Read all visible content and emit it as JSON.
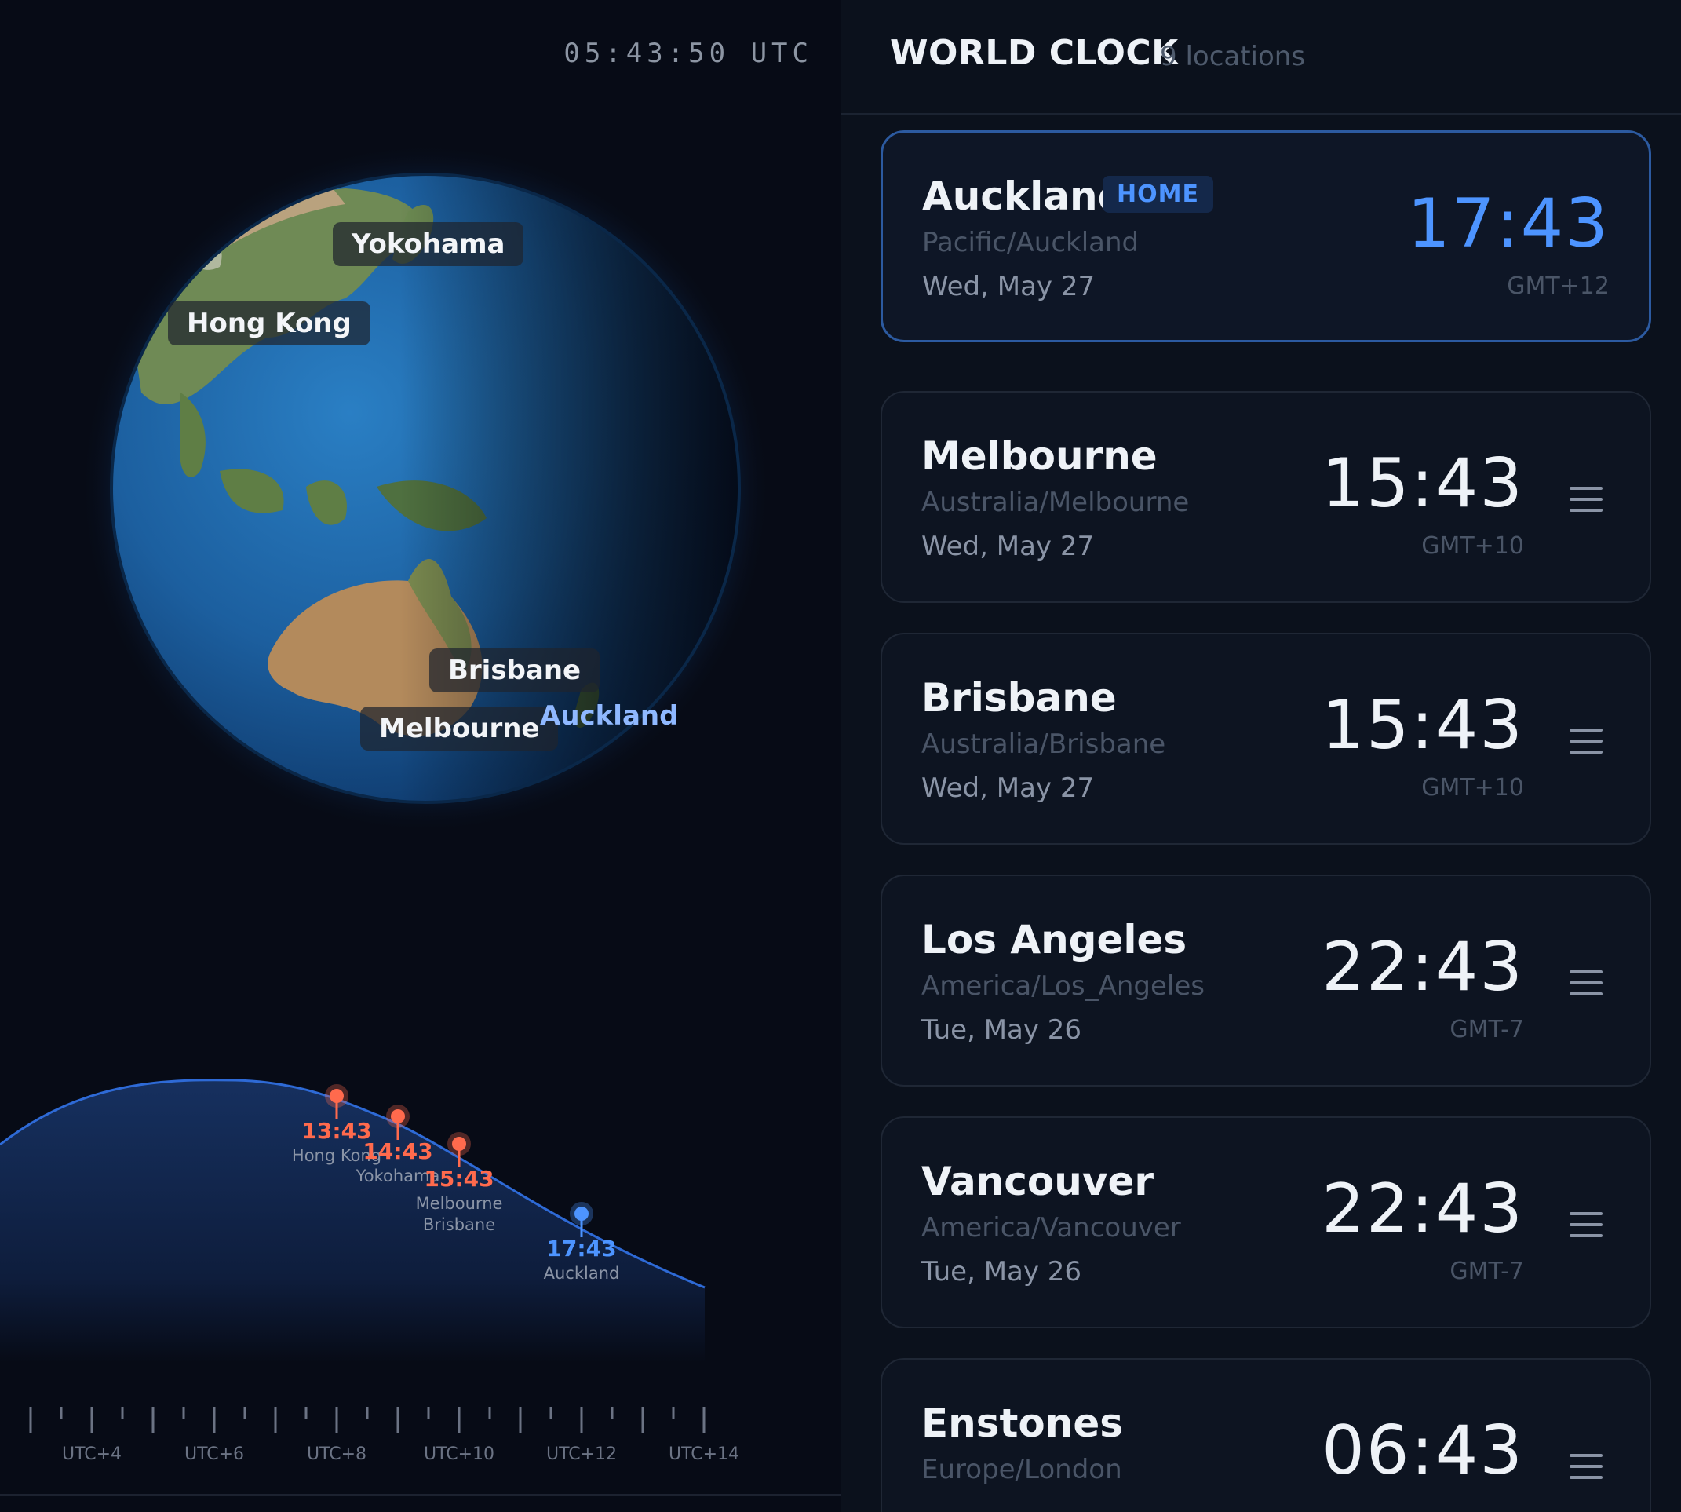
{
  "utc_clock": "05:43:50  UTC",
  "globe": {
    "labels": [
      {
        "name": "Yokohama"
      },
      {
        "name": "Hong Kong"
      },
      {
        "name": "Brisbane"
      },
      {
        "name": "Melbourne"
      },
      {
        "name": "Auckland"
      }
    ]
  },
  "daylight": {
    "markers": [
      {
        "time": "13:43",
        "cities": [
          "Hong Kong"
        ],
        "color": "#ff6a4d"
      },
      {
        "time": "14:43",
        "cities": [
          "Yokohama"
        ],
        "color": "#ff6a4d"
      },
      {
        "time": "15:43",
        "cities": [
          "Melbourne",
          "Brisbane"
        ],
        "color": "#ff6a4d"
      },
      {
        "time": "17:43",
        "cities": [
          "Auckland"
        ],
        "color": "#4d94ff"
      }
    ]
  },
  "tz_scale": {
    "labels": [
      "UTC+4",
      "UTC+6",
      "UTC+8",
      "UTC+10",
      "UTC+12",
      "UTC+14"
    ]
  },
  "header": {
    "title": "WORLD CLOCK",
    "count": "9 locations"
  },
  "cards": [
    {
      "name": "Auckland",
      "zone": "Pacific/Auckland",
      "date": "Wed, May 27",
      "time": "17:43",
      "gmt": "GMT+12",
      "home": true,
      "badge": "HOME"
    },
    {
      "name": "Melbourne",
      "zone": "Australia/Melbourne",
      "date": "Wed, May 27",
      "time": "15:43",
      "gmt": "GMT+10"
    },
    {
      "name": "Brisbane",
      "zone": "Australia/Brisbane",
      "date": "Wed, May 27",
      "time": "15:43",
      "gmt": "GMT+10"
    },
    {
      "name": "Los Angeles",
      "zone": "America/Los_Angeles",
      "date": "Tue, May 26",
      "time": "22:43",
      "gmt": "GMT-7"
    },
    {
      "name": "Vancouver",
      "zone": "America/Vancouver",
      "date": "Tue, May 26",
      "time": "22:43",
      "gmt": "GMT-7"
    },
    {
      "name": "Enstones",
      "zone": "Europe/London",
      "date": "",
      "time": "06:43",
      "gmt": ""
    }
  ],
  "colors": {
    "accent": "#4d94ff",
    "marker": "#ff6a4d",
    "ocean": "#1b5d9c",
    "background": "#070b16"
  }
}
